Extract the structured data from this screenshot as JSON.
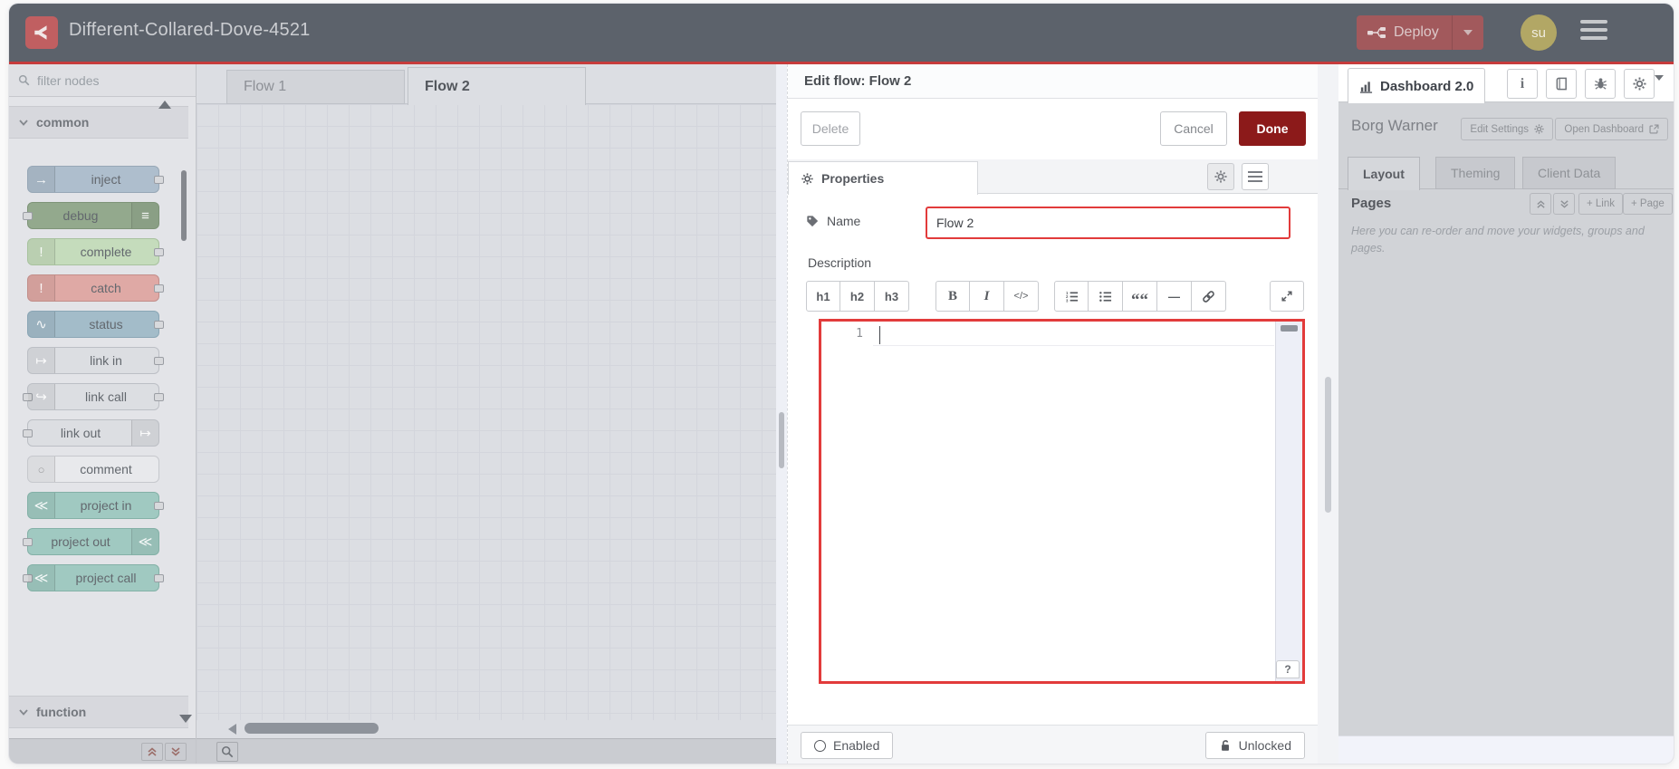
{
  "colors": {
    "header_bg": "#5c626b",
    "accent_red_line": "#c63c3c",
    "deploy_bg": "#a2595c",
    "done_red": "#8c1a1a",
    "focus_red": "#e23b3b",
    "avatar_bg": "#b2a765",
    "sidebar_bg": "#d1d3d7"
  },
  "header": {
    "title": "Different-Collared-Dove-4521",
    "deploy_label": "Deploy",
    "avatar_initials": "su"
  },
  "palette": {
    "search_placeholder": "filter nodes",
    "categories": [
      {
        "label": "common"
      },
      {
        "label": "function"
      }
    ],
    "nodes": [
      {
        "label": "inject",
        "icon": "inject-arrow-icon",
        "glyph": "→",
        "icon_side": "left",
        "ports": [
          "right"
        ],
        "bg": "#aebecd",
        "border": "#97a7b6"
      },
      {
        "label": "debug",
        "icon": "debug-list-icon",
        "glyph": "≡",
        "icon_side": "right",
        "ports": [
          "left"
        ],
        "bg": "#93a98d",
        "border": "#7e9478"
      },
      {
        "label": "complete",
        "icon": "exclamation-icon",
        "glyph": "!",
        "icon_side": "left",
        "ports": [
          "right"
        ],
        "bg": "#c5dcbc",
        "border": "#a8c29e"
      },
      {
        "label": "catch",
        "icon": "exclamation-icon",
        "glyph": "!",
        "icon_side": "left",
        "ports": [
          "right"
        ],
        "bg": "#dfa9a5",
        "border": "#c28e8a"
      },
      {
        "label": "status",
        "icon": "pulse-icon",
        "glyph": "∿",
        "icon_side": "left",
        "ports": [
          "right"
        ],
        "bg": "#a3bcc9",
        "border": "#8aa6b5"
      },
      {
        "label": "link in",
        "icon": "link-in-icon",
        "glyph": "↦",
        "icon_side": "left",
        "ports": [
          "right"
        ],
        "bg": "#dcdee2",
        "border": "#bcbfc5"
      },
      {
        "label": "link call",
        "icon": "link-call-icon",
        "glyph": "↪",
        "icon_side": "left",
        "ports": [
          "left",
          "right"
        ],
        "bg": "#dcdee2",
        "border": "#bcbfc5"
      },
      {
        "label": "link out",
        "icon": "link-out-icon",
        "glyph": "↦",
        "icon_side": "right",
        "ports": [
          "left"
        ],
        "bg": "#dcdee2",
        "border": "#bcbfc5"
      },
      {
        "label": "comment",
        "icon": "comment-bubble-icon",
        "glyph": "○",
        "icon_side": "left",
        "ports": [],
        "bg": "#e8e9ec",
        "border": "#c6c8cd",
        "dim_icon": true
      },
      {
        "label": "project in",
        "icon": "node-red-icon",
        "glyph": "≪",
        "icon_side": "left",
        "ports": [
          "right"
        ],
        "bg": "#a0c9c1",
        "border": "#84b1a7"
      },
      {
        "label": "project out",
        "icon": "node-red-icon",
        "glyph": "≪",
        "icon_side": "right",
        "ports": [
          "left"
        ],
        "bg": "#a0c9c1",
        "border": "#84b1a7"
      },
      {
        "label": "project call",
        "icon": "node-red-icon",
        "glyph": "≪",
        "icon_side": "left",
        "ports": [
          "left",
          "right"
        ],
        "bg": "#a0c9c1",
        "border": "#84b1a7"
      }
    ]
  },
  "workspace": {
    "tabs": [
      {
        "label": "Flow 1",
        "active": false
      },
      {
        "label": "Flow 2",
        "active": true
      }
    ]
  },
  "dialog": {
    "title": "Edit flow: Flow 2",
    "delete_label": "Delete",
    "cancel_label": "Cancel",
    "done_label": "Done",
    "properties_tab": "Properties",
    "name_label": "Name",
    "name_value": "Flow 2",
    "description_label": "Description",
    "toolbar": {
      "h1": "h1",
      "h2": "h2",
      "h3": "h3",
      "bold": "B",
      "italic": "I",
      "code": "</>"
    },
    "editor": {
      "line_number": "1"
    },
    "help_button": "?",
    "footer": {
      "enabled_label": "Enabled",
      "locked_label": "Unlocked"
    }
  },
  "sidebar": {
    "tab_label": "Dashboard 2.0",
    "project_name": "Borg Warner",
    "edit_settings_label": "Edit Settings",
    "open_dashboard_label": "Open Dashboard",
    "tabs": [
      {
        "label": "Layout",
        "active": true
      },
      {
        "label": "Theming",
        "active": false
      },
      {
        "label": "Client Data",
        "active": false
      }
    ],
    "pages_label": "Pages",
    "add_link_label": "+ Link",
    "add_page_label": "+ Page",
    "help_text": "Here you can re-order and move your widgets, groups and pages."
  }
}
